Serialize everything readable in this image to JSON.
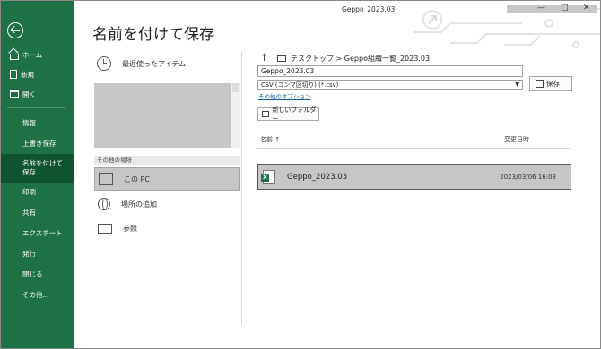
{
  "window": {
    "title": "Geppo_2023.03",
    "minimize": "—",
    "maximize": "□",
    "close": "✕"
  },
  "sidebar": {
    "back_icon": "back-arrow-icon",
    "items": [
      {
        "label": "ホーム",
        "icon": "home-icon"
      },
      {
        "label": "新規",
        "icon": "new-document-icon"
      },
      {
        "label": "開く",
        "icon": "open-folder-icon"
      },
      {
        "label": "情報"
      },
      {
        "label": "上書き保存"
      },
      {
        "label": "名前を付けて保存",
        "active": true
      },
      {
        "label": "印刷"
      },
      {
        "label": "共有"
      },
      {
        "label": "エクスポート"
      },
      {
        "label": "発行"
      },
      {
        "label": "閉じる"
      },
      {
        "label": "その他..."
      }
    ]
  },
  "page": {
    "title": "名前を付けて保存"
  },
  "locations": {
    "recent_label": "最近使ったアイテム",
    "other_header": "その他の場所",
    "items": [
      {
        "label": "この PC",
        "icon": "pc-icon",
        "selected": true
      },
      {
        "label": "場所の追加",
        "icon": "globe-icon"
      },
      {
        "label": "参照",
        "icon": "folder-icon"
      }
    ]
  },
  "save_pane": {
    "breadcrumb": "デスクトップ > Geppo組織一覧_2023.03",
    "filename_value": "Geppo_2023.03",
    "filetype_value": "CSV (コンマ区切り) (*.csv)",
    "more_options": "その他のオプション",
    "save_button": "保存",
    "new_folder_button": "新しいフォルダー",
    "col_name": "名前 ↑",
    "col_modified": "変更日時",
    "files": [
      {
        "name": "Geppo_2023.03",
        "modified": "2023/03/06 16:03",
        "icon": "excel-file-icon",
        "icon_letter": "X"
      }
    ]
  },
  "colors": {
    "sidebar_bg": "#1e7145",
    "sidebar_active": "#10542f",
    "selection": "#c6c6c6",
    "link": "#1a5e9b"
  }
}
